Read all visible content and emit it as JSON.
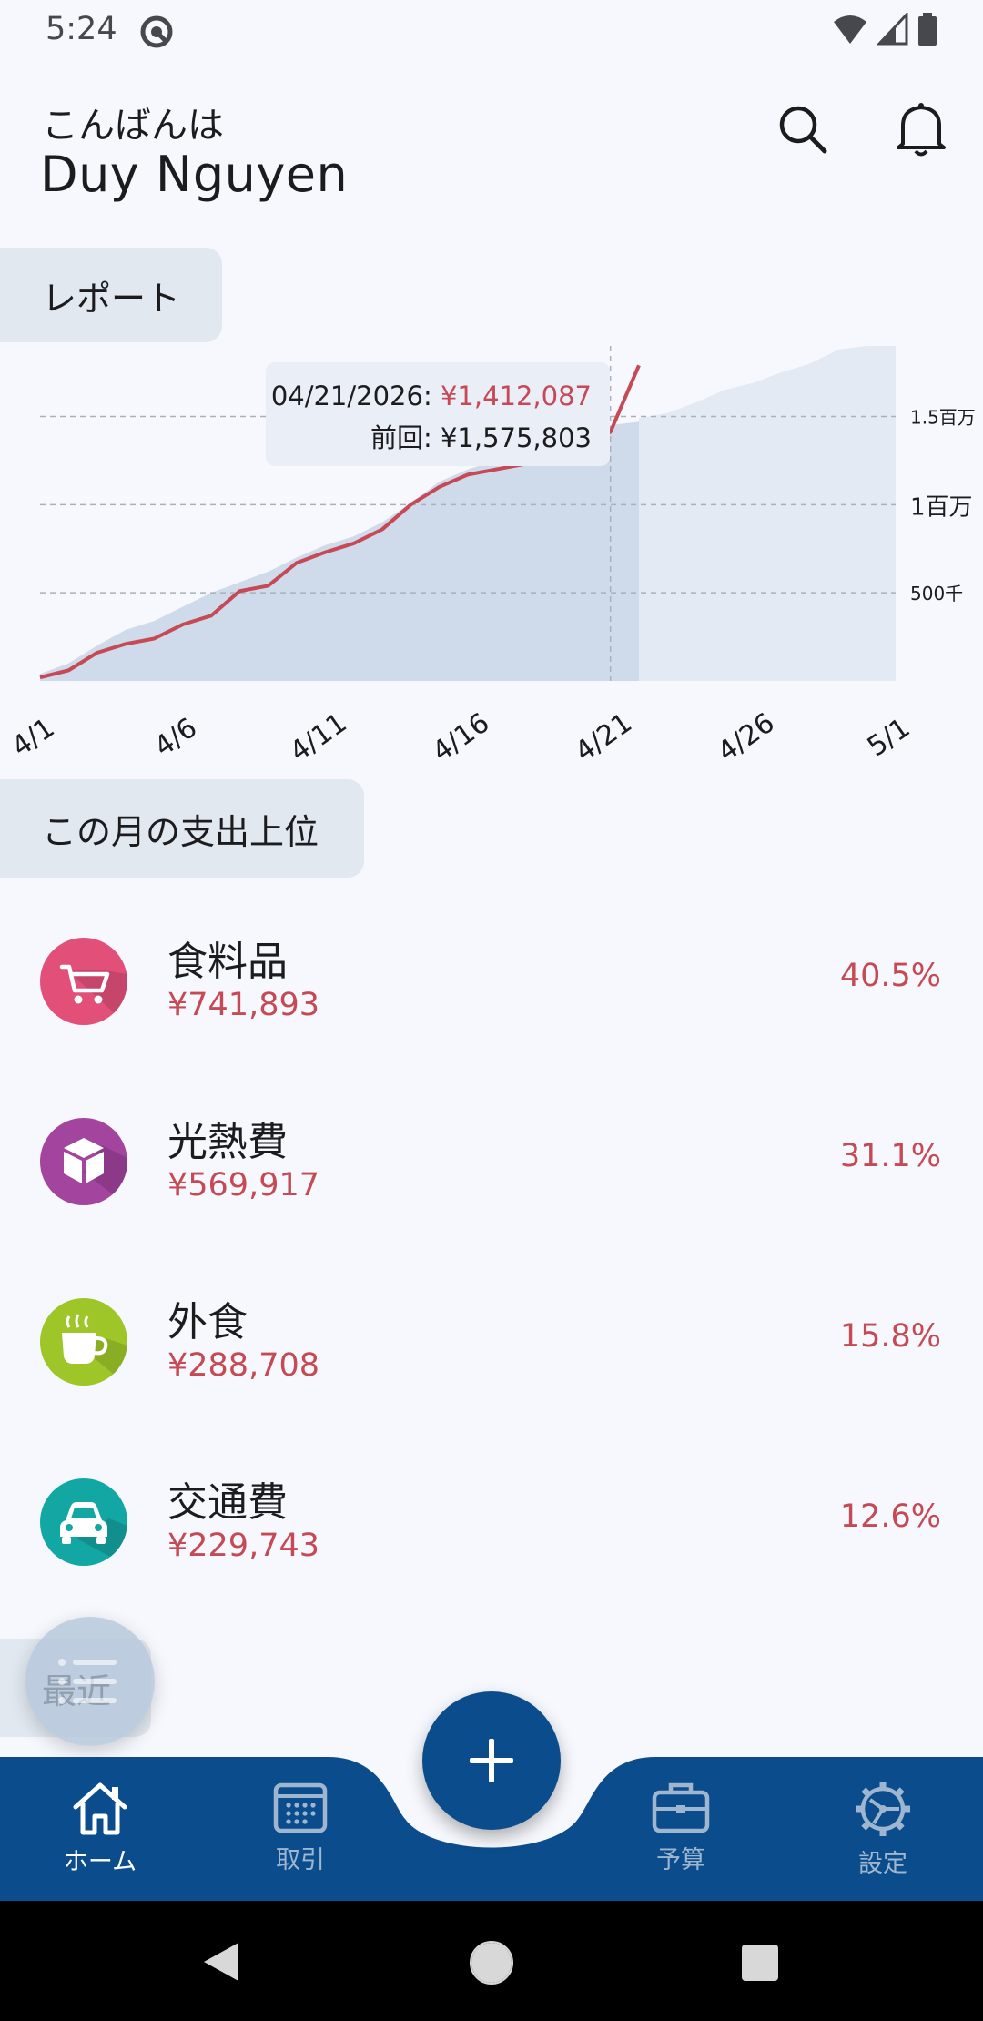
{
  "status_bar": {
    "time": "5:24"
  },
  "header": {
    "greeting": "こんばんは",
    "user_name": "Duy Nguyen"
  },
  "report": {
    "title": "レポート",
    "tooltip": {
      "date_prefix": "04/21/2026: ",
      "current_value": "¥1,412,087",
      "previous_label": "前回: ¥1,575,803"
    }
  },
  "chart_data": {
    "type": "area",
    "x_tick_labels": [
      "4/1",
      "4/6",
      "4/11",
      "4/16",
      "4/21",
      "4/26",
      "5/1"
    ],
    "y_tick_labels": [
      "500千",
      "1百万",
      "1.5百万"
    ],
    "y_ticks": [
      500000,
      1000000,
      1500000
    ],
    "ylim": [
      0,
      1900000
    ],
    "xlim": [
      1,
      31
    ],
    "grid": "horizontal dashed",
    "highlight_day": 21,
    "series": [
      {
        "kind": "line",
        "color": "#c54a55",
        "x": [
          1,
          2,
          3,
          4,
          5,
          6,
          7,
          8,
          9,
          10,
          11,
          12,
          13,
          14,
          15,
          16,
          17,
          18,
          19,
          20,
          21,
          22
        ],
        "y": [
          20000,
          60000,
          160000,
          210000,
          240000,
          320000,
          370000,
          510000,
          540000,
          670000,
          730000,
          780000,
          860000,
          1000000,
          1100000,
          1170000,
          1200000,
          1230000,
          1300000,
          1330000,
          1412087,
          1790000
        ]
      },
      {
        "kind": "area",
        "color": "#cfdbea",
        "x": [
          1,
          2,
          3,
          4,
          5,
          6,
          7,
          8,
          9,
          10,
          11,
          12,
          13,
          14,
          15,
          16,
          17,
          18,
          19,
          20,
          21,
          22
        ],
        "y": [
          40000,
          100000,
          200000,
          290000,
          340000,
          420000,
          500000,
          560000,
          620000,
          700000,
          770000,
          820000,
          900000,
          1010000,
          1130000,
          1200000,
          1250000,
          1290000,
          1360000,
          1400000,
          1450000,
          1470000
        ]
      },
      {
        "kind": "area",
        "color": "#e3eaf4",
        "x": [
          22,
          23,
          24,
          25,
          26,
          27,
          28,
          29,
          30,
          31
        ],
        "y": [
          1490000,
          1520000,
          1580000,
          1650000,
          1690000,
          1750000,
          1800000,
          1880000,
          1900000,
          1900000
        ]
      }
    ]
  },
  "top_spending": {
    "title": "この月の支出上位",
    "items": [
      {
        "name": "食料品",
        "amount": "¥741,893",
        "percent": "40.5%",
        "color": "#e2507a",
        "icon": "cart-icon"
      },
      {
        "name": "光熱費",
        "amount": "¥569,917",
        "percent": "31.1%",
        "color": "#a3449f",
        "icon": "box-icon"
      },
      {
        "name": "外食",
        "amount": "¥288,708",
        "percent": "15.8%",
        "color": "#9ec628",
        "icon": "coffee-cup-icon"
      },
      {
        "name": "交通費",
        "amount": "¥229,743",
        "percent": "12.6%",
        "color": "#13a7a4",
        "icon": "car-icon"
      }
    ]
  },
  "recent": {
    "title": "最近"
  },
  "bottom_nav": {
    "items": [
      {
        "label": "ホーム",
        "icon": "home-icon",
        "active": true
      },
      {
        "label": "取引",
        "icon": "calendar-icon",
        "active": false
      },
      {
        "label": "予算",
        "icon": "briefcase-icon",
        "active": false
      },
      {
        "label": "設定",
        "icon": "gear-icon",
        "active": false
      }
    ],
    "color": "#0a4c8c"
  }
}
